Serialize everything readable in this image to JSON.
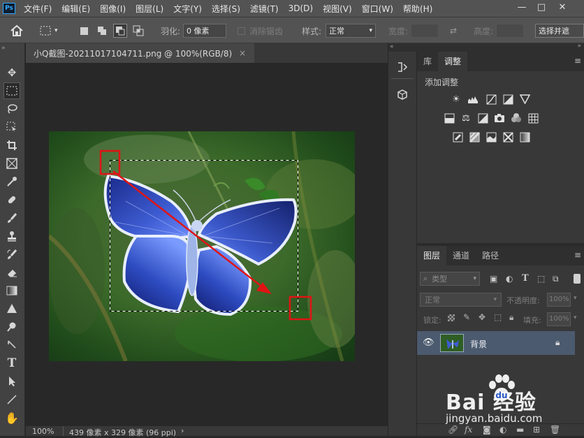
{
  "menubar": {
    "logo": "Ps",
    "items": [
      "文件(F)",
      "编辑(E)",
      "图像(I)",
      "图层(L)",
      "文字(Y)",
      "选择(S)",
      "滤镜(T)",
      "3D(D)",
      "视图(V)",
      "窗口(W)",
      "帮助(H)"
    ],
    "window_controls": {
      "minimize": "—",
      "restore": "□",
      "close": "✕"
    }
  },
  "options": {
    "feather_label": "羽化:",
    "feather_value": "0 像素",
    "antialias_label": "消除锯齿",
    "style_label": "样式:",
    "style_value": "正常",
    "width_label": "宽度:",
    "height_label": "高度:",
    "select_mask_label": "选择并遮"
  },
  "document": {
    "tab_title": "小Q截图-20211017104711.png @ 100%(RGB/8)",
    "close": "×",
    "zoom": "100%",
    "info": "439 像素 x 329 像素 (96 ppi)"
  },
  "adjust_panel": {
    "tabs": [
      "库",
      "调整"
    ],
    "active_tab": "调整",
    "title": "添加调整"
  },
  "layers_panel": {
    "tabs": [
      "图层",
      "通道",
      "路径"
    ],
    "active_tab": "图层",
    "filter_value": "类型",
    "blend_mode": "正常",
    "opacity_label": "不透明度:",
    "opacity_value": "100%",
    "lock_label": "锁定:",
    "fill_label": "填充:",
    "fill_value": "100%",
    "layers": [
      {
        "name": "背景",
        "visible": true,
        "locked": true
      }
    ],
    "footer_icons": [
      "link-icon",
      "fx-icon",
      "mask-icon",
      "adjustment-icon",
      "group-icon",
      "new-layer-icon",
      "trash-icon"
    ],
    "footer_fx": "fx"
  },
  "watermark": {
    "brand": "Bai  经验",
    "site": "jingyan.baidu.com"
  },
  "colors": {
    "selection_box": "#e01414",
    "arrow": "#e01414",
    "layer_selected": "#4b5a6e"
  }
}
